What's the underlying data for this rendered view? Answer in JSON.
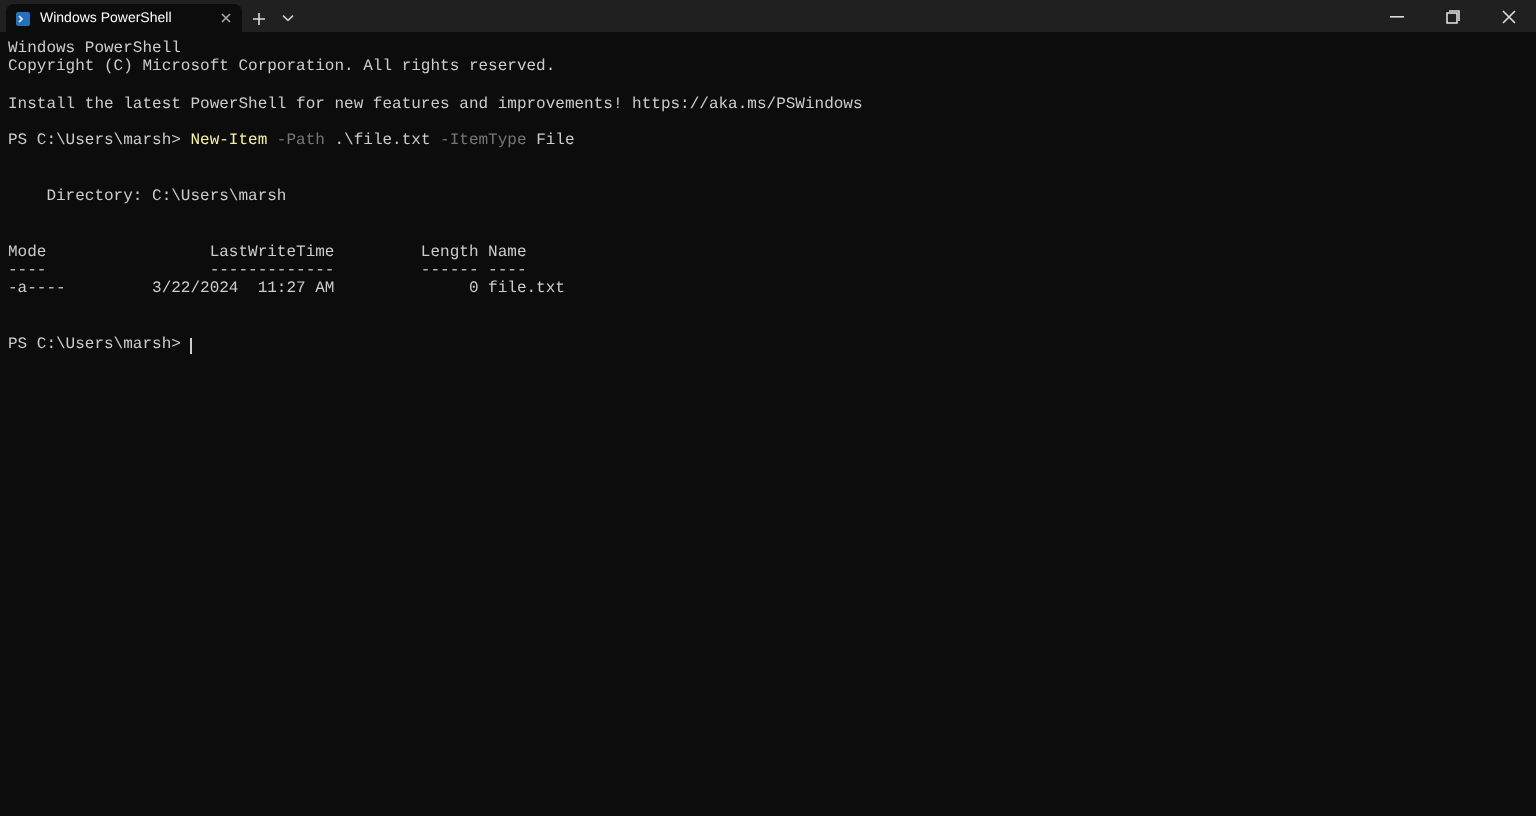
{
  "tab": {
    "title": "Windows PowerShell",
    "selected": true
  },
  "lines": [
    {
      "kind": "text",
      "segments": [
        {
          "kind": "plain",
          "text": "Windows PowerShell"
        }
      ]
    },
    {
      "kind": "text",
      "segments": [
        {
          "kind": "plain",
          "text": "Copyright (C) Microsoft Corporation. All rights reserved."
        }
      ]
    },
    {
      "kind": "blank"
    },
    {
      "kind": "text",
      "segments": [
        {
          "kind": "plain",
          "text": "Install the latest PowerShell for new features and improvements! https://aka.ms/PSWindows"
        }
      ]
    },
    {
      "kind": "blank"
    },
    {
      "kind": "text",
      "segments": [
        {
          "kind": "plain",
          "text": "PS C:\\Users\\marsh> "
        },
        {
          "kind": "command",
          "text": "New-Item"
        },
        {
          "kind": "param",
          "text": " -Path"
        },
        {
          "kind": "plain",
          "text": " .\\file.txt"
        },
        {
          "kind": "param",
          "text": " -ItemType"
        },
        {
          "kind": "plain",
          "text": " File"
        }
      ]
    },
    {
      "kind": "blank"
    },
    {
      "kind": "blank"
    },
    {
      "kind": "text",
      "segments": [
        {
          "kind": "plain",
          "text": "    Directory: C:\\Users\\marsh"
        }
      ]
    },
    {
      "kind": "blank"
    },
    {
      "kind": "blank"
    },
    {
      "kind": "text",
      "segments": [
        {
          "kind": "plain",
          "text": "Mode                 LastWriteTime         Length Name"
        }
      ]
    },
    {
      "kind": "text",
      "segments": [
        {
          "kind": "plain",
          "text": "----                 -------------         ------ ----"
        }
      ]
    },
    {
      "kind": "text",
      "segments": [
        {
          "kind": "plain",
          "text": "-a----         3/22/2024  11:27 AM              0 file.txt"
        }
      ]
    },
    {
      "kind": "blank"
    },
    {
      "kind": "blank"
    },
    {
      "kind": "prompt",
      "segments": [
        {
          "kind": "plain",
          "text": "PS C:\\Users\\marsh> "
        }
      ]
    }
  ]
}
